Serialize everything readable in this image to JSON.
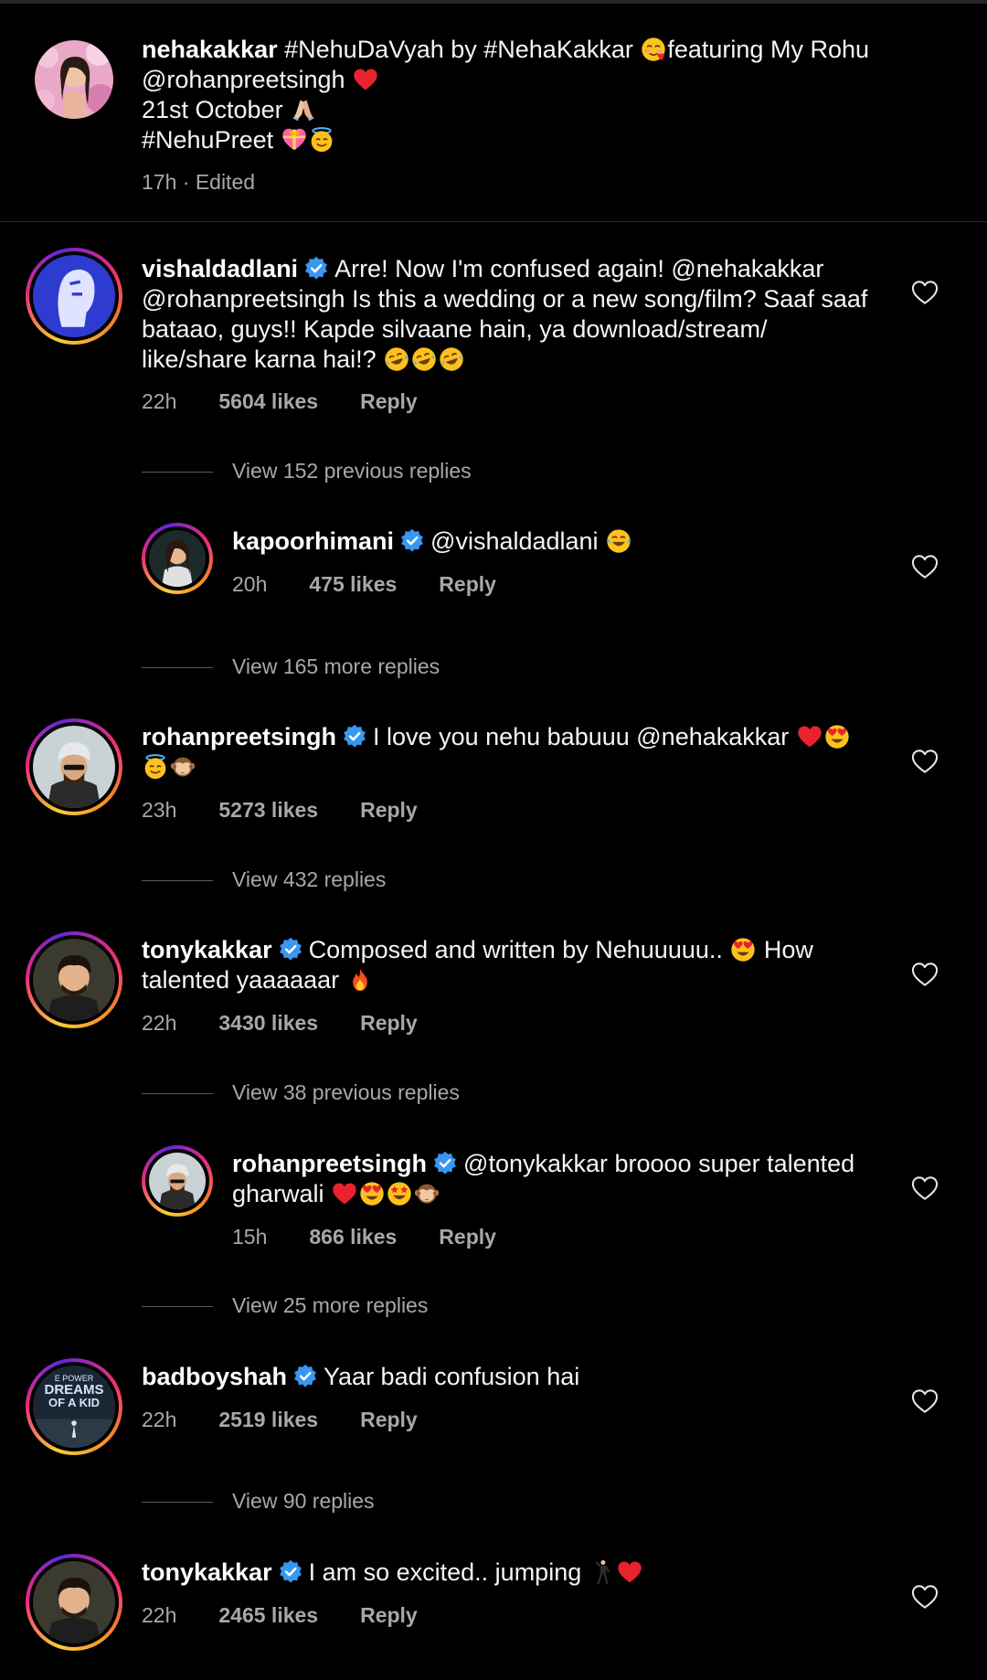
{
  "post": {
    "username": "nehakakkar",
    "caption_line1": "#NehuDaVyah by #NehaKakkar",
    "caption_line1b": "featuring My Rohu",
    "caption_line2": "@rohanpreetsingh",
    "caption_line3": "21st October",
    "caption_line4": "#NehuPreet",
    "meta": "17h · Edited"
  },
  "comments": [
    {
      "username": "vishaldadlani",
      "text": "Arre! Now I'm confused again! @nehakakkar @rohanpreetsingh Is this a wedding or a new song/film? Saaf saaf bataao, guys!! Kapde silvaane hain, ya download/stream/ like/share karna hai!?",
      "time": "22h",
      "likes": "5604 likes",
      "reply": "Reply",
      "view_replies": "View 152 previous replies"
    },
    {
      "username": "kapoorhimani",
      "text": "@vishaldadlani",
      "time": "20h",
      "likes": "475 likes",
      "reply": "Reply",
      "view_replies": "View 165 more replies"
    },
    {
      "username": "rohanpreetsingh",
      "text": "I love you nehu babuuu @nehakakkar",
      "time": "23h",
      "likes": "5273 likes",
      "reply": "Reply",
      "view_replies": "View 432 replies"
    },
    {
      "username": "tonykakkar",
      "text": "Composed and written by Nehuuuuu..",
      "text2": "How talented yaaaaaar",
      "time": "22h",
      "likes": "3430 likes",
      "reply": "Reply",
      "view_replies": "View 38 previous replies"
    },
    {
      "username": "rohanpreetsingh",
      "text": "@tonykakkar broooo super talented gharwali",
      "time": "15h",
      "likes": "866 likes",
      "reply": "Reply",
      "view_replies": "View 25 more replies"
    },
    {
      "username": "badboyshah",
      "text": "Yaar badi confusion hai",
      "time": "22h",
      "likes": "2519 likes",
      "reply": "Reply",
      "view_replies": "View 90 replies"
    },
    {
      "username": "tonykakkar",
      "text": "I am so excited.. jumping",
      "time": "22h",
      "likes": "2465 likes",
      "reply": "Reply"
    }
  ],
  "avatar_art": {
    "badboyshah_line1": "E POWER",
    "badboyshah_line2": "DREAMS",
    "badboyshah_line3": "OF A KID"
  },
  "icons": {
    "verified": "verified-badge-icon",
    "heart": "heart-outline-icon"
  },
  "colors": {
    "background": "#000000",
    "text": "#ffffff",
    "secondary": "#a8a8a8",
    "verified": "#3897f0",
    "heart_emoji": "#e8232e"
  }
}
